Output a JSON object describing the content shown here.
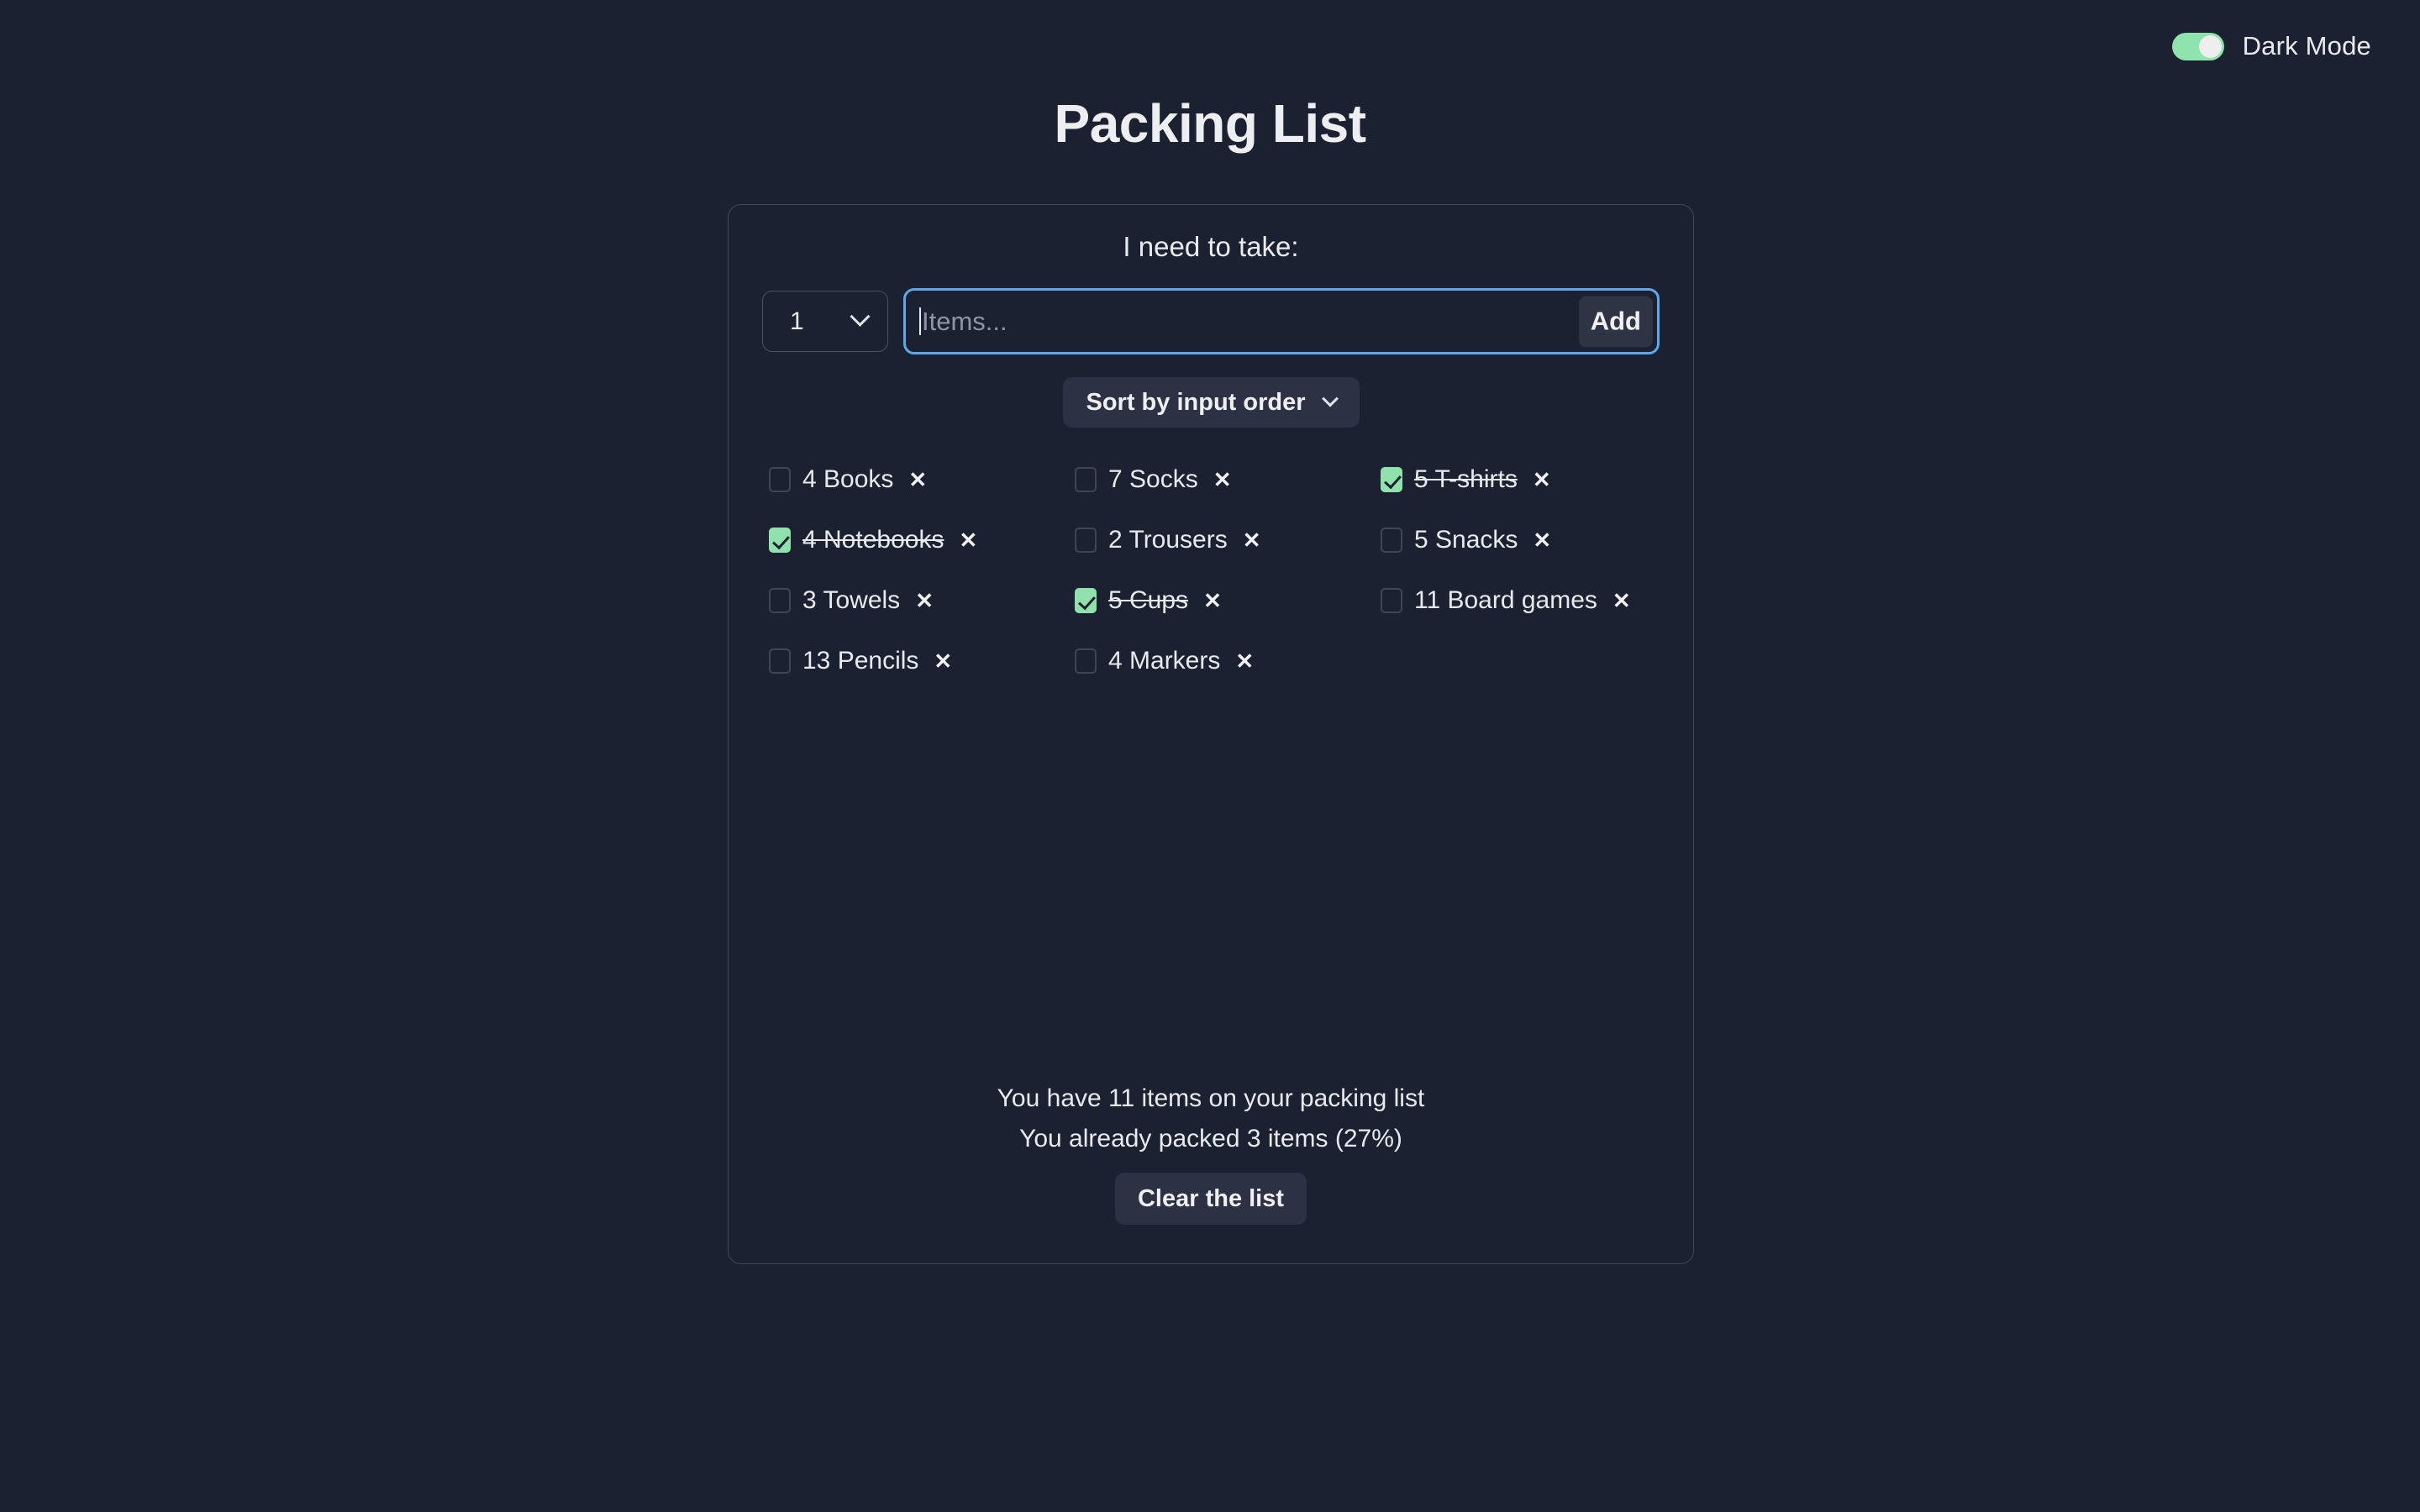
{
  "app": {
    "title": "Packing List",
    "background_color": "#1b2130",
    "accent_green": "#90e1ab",
    "focus_blue": "#5aaaeb"
  },
  "dark_mode": {
    "label": "Dark Mode",
    "enabled": true
  },
  "form": {
    "heading": "I need to take:",
    "quantity_value": "1",
    "quantity_icon": "chevron-down-icon",
    "item_placeholder": "Items...",
    "item_value": "",
    "add_label": "Add"
  },
  "sort": {
    "label": "Sort by input order",
    "icon": "chevron-down-icon"
  },
  "items": [
    {
      "quantity": "4",
      "name": "Books",
      "label": "4 Books",
      "packed": false,
      "delete": "✕"
    },
    {
      "quantity": "7",
      "name": "Socks",
      "label": "7 Socks",
      "packed": false,
      "delete": "✕"
    },
    {
      "quantity": "5",
      "name": "T-shirts",
      "label": "5 T-shirts",
      "packed": true,
      "delete": "✕"
    },
    {
      "quantity": "4",
      "name": "Notebooks",
      "label": "4 Notebooks",
      "packed": true,
      "delete": "✕"
    },
    {
      "quantity": "2",
      "name": "Trousers",
      "label": "2 Trousers",
      "packed": false,
      "delete": "✕"
    },
    {
      "quantity": "5",
      "name": "Snacks",
      "label": "5 Snacks",
      "packed": false,
      "delete": "✕"
    },
    {
      "quantity": "3",
      "name": "Towels",
      "label": "3 Towels",
      "packed": false,
      "delete": "✕"
    },
    {
      "quantity": "5",
      "name": "Cups",
      "label": "5 Cups",
      "packed": true,
      "delete": "✕"
    },
    {
      "quantity": "11",
      "name": "Board games",
      "label": "11 Board games",
      "packed": false,
      "delete": "✕"
    },
    {
      "quantity": "13",
      "name": "Pencils",
      "label": "13 Pencils",
      "packed": false,
      "delete": "✕"
    },
    {
      "quantity": "4",
      "name": "Markers",
      "label": "4 Markers",
      "packed": false,
      "delete": "✕"
    }
  ],
  "stats": {
    "total_line": "You have 11 items on your packing list",
    "packed_line": "You already packed 3 items (27%)",
    "total_count": 11,
    "packed_count": 3,
    "packed_percent": 27
  },
  "footer": {
    "clear_label": "Clear the list"
  }
}
